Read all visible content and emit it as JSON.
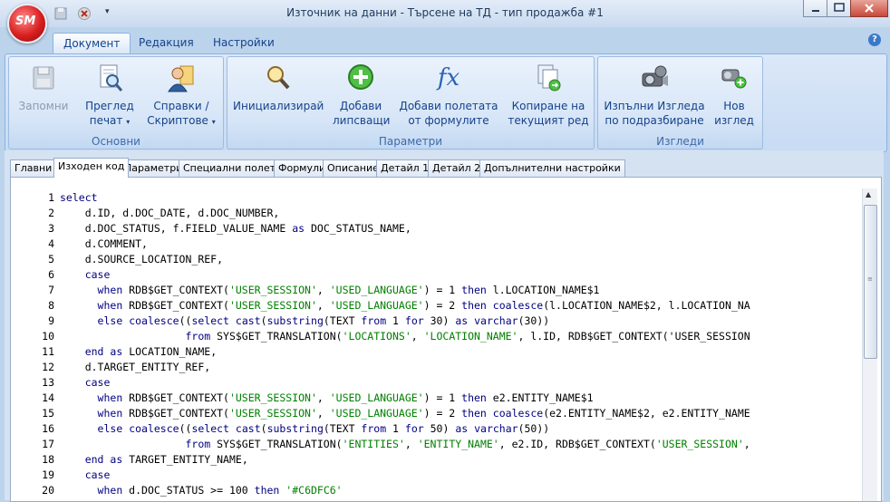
{
  "window": {
    "title": "Източник на данни - Търсене на ТД - тип продажба #1",
    "logo_text": "SM"
  },
  "ribbon_tabs": [
    {
      "label": "Документ",
      "active": true
    },
    {
      "label": "Редакция",
      "active": false
    },
    {
      "label": "Настройки",
      "active": false
    }
  ],
  "groups": {
    "basic": {
      "label": "Основни",
      "save": "Запомни",
      "preview_l1": "Преглед",
      "preview_l2": "печат",
      "reports_l1": "Справки /",
      "reports_l2": "Скриптове"
    },
    "params": {
      "label": "Параметри",
      "init": "Инициализирай",
      "add_missing_l1": "Добави",
      "add_missing_l2": "липсващи",
      "add_formula_l1": "Добави полетата",
      "add_formula_l2": "от формулите",
      "copy_l1": "Копиране на",
      "copy_l2": "текущият ред"
    },
    "views": {
      "label": "Изгледи",
      "default_l1": "Изпълни Изгледа",
      "default_l2": "по подразбиране",
      "new_l1": "Нов",
      "new_l2": "изглед"
    }
  },
  "doc_tabs": [
    {
      "label": "Главни"
    },
    {
      "label": "Изходен код"
    },
    {
      "label": "Параметри"
    },
    {
      "label": "Специални полета"
    },
    {
      "label": "Формули"
    },
    {
      "label": "Описание"
    },
    {
      "label": "Детайл 1"
    },
    {
      "label": "Детайл 2"
    },
    {
      "label": "Допълнителни настройки"
    }
  ],
  "code_lines": [
    {
      "n": "1",
      "t": "select"
    },
    {
      "n": "2",
      "t": "    d.ID, d.DOC_DATE, d.DOC_NUMBER,"
    },
    {
      "n": "3",
      "t": "    d.DOC_STATUS, f.FIELD_VALUE_NAME as DOC_STATUS_NAME,"
    },
    {
      "n": "4",
      "t": "    d.COMMENT,"
    },
    {
      "n": "5",
      "t": "    d.SOURCE_LOCATION_REF,"
    },
    {
      "n": "6",
      "t": "    case"
    },
    {
      "n": "7",
      "t": "      when RDB$GET_CONTEXT('USER_SESSION', 'USED_LANGUAGE') = 1 then l.LOCATION_NAME$1"
    },
    {
      "n": "8",
      "t": "      when RDB$GET_CONTEXT('USER_SESSION', 'USED_LANGUAGE') = 2 then coalesce(l.LOCATION_NAME$2, l.LOCATION_NA"
    },
    {
      "n": "9",
      "t": "      else coalesce((select cast(substring(TEXT from 1 for 30) as varchar(30))"
    },
    {
      "n": "10",
      "t": "                    from SYS$GET_TRANSLATION('LOCATIONS', 'LOCATION_NAME', l.ID, RDB$GET_CONTEXT('USER_SESSION"
    },
    {
      "n": "11",
      "t": "    end as LOCATION_NAME,"
    },
    {
      "n": "12",
      "t": "    d.TARGET_ENTITY_REF,"
    },
    {
      "n": "13",
      "t": "    case"
    },
    {
      "n": "14",
      "t": "      when RDB$GET_CONTEXT('USER_SESSION', 'USED_LANGUAGE') = 1 then e2.ENTITY_NAME$1"
    },
    {
      "n": "15",
      "t": "      when RDB$GET_CONTEXT('USER_SESSION', 'USED_LANGUAGE') = 2 then coalesce(e2.ENTITY_NAME$2, e2.ENTITY_NAME"
    },
    {
      "n": "16",
      "t": "      else coalesce((select cast(substring(TEXT from 1 for 50) as varchar(50))"
    },
    {
      "n": "17",
      "t": "                    from SYS$GET_TRANSLATION('ENTITIES', 'ENTITY_NAME', e2.ID, RDB$GET_CONTEXT('USER_SESSION',"
    },
    {
      "n": "18",
      "t": "    end as TARGET_ENTITY_NAME,"
    },
    {
      "n": "19",
      "t": "    case"
    },
    {
      "n": "20",
      "t": "      when d.DOC_STATUS >= 100 then '#C6DFC6'"
    }
  ]
}
